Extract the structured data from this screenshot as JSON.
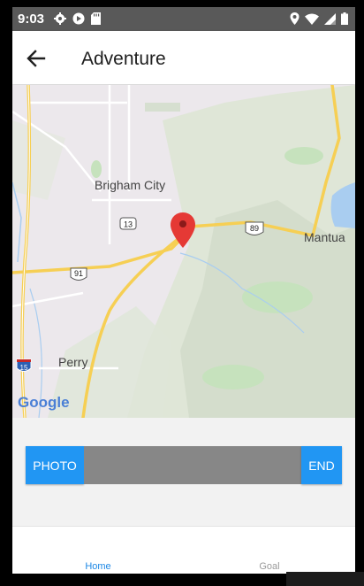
{
  "status_bar": {
    "time": "9:03",
    "left_icons": [
      "gear-icon",
      "play-store-icon",
      "sd-card-icon"
    ],
    "right_icons": [
      "location-pin-icon",
      "wifi-icon",
      "signal-icon",
      "battery-icon"
    ]
  },
  "app_bar": {
    "back_icon": "arrow-left-icon",
    "title": "Adventure"
  },
  "map": {
    "labels": {
      "brigham_city": "Brigham City",
      "mantua": "Mantua",
      "perry": "Perry"
    },
    "shields": {
      "route_13": "13",
      "route_89": "89",
      "route_91": "91",
      "interstate_15": "15"
    },
    "logo": "Google",
    "marker_color": "#e53935"
  },
  "controls": {
    "photo_label": "PHOTO",
    "end_label": "END",
    "progress": 0
  },
  "bottom_nav": {
    "items": [
      {
        "label": "Home",
        "active": true
      },
      {
        "label": "Goal",
        "active": false
      }
    ]
  },
  "colors": {
    "accent": "#2196f3",
    "status_bar": "#595959",
    "progress_track": "#878787"
  }
}
